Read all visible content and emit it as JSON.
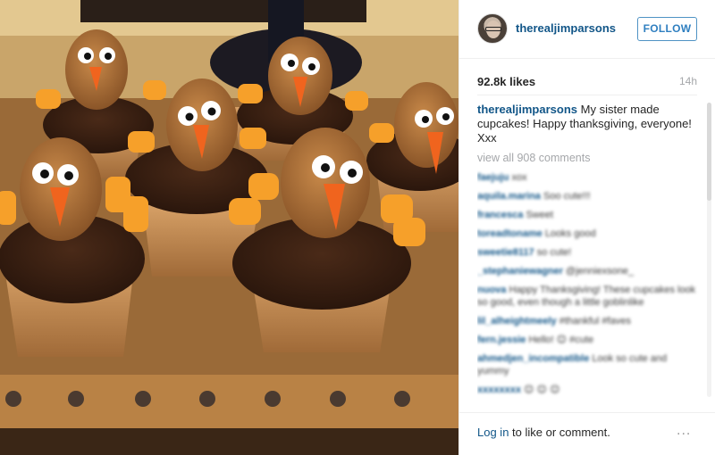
{
  "post": {
    "username": "therealjimparsons",
    "follow_label": "FOLLOW",
    "likes": "92.8k likes",
    "time_ago": "14h",
    "caption_user": "therealjimparsons",
    "caption_text": "My sister made cupcakes! Happy thanksgiving, everyone! Xxx",
    "view_all": "view all 908 comments",
    "comments": [
      {
        "user": "faejuju",
        "text": "xox"
      },
      {
        "user": "aquila.marina",
        "text": "Soo cute!!!"
      },
      {
        "user": "francesca",
        "text": "Sweet"
      },
      {
        "user": "toreadtoname",
        "text": "Looks good"
      },
      {
        "user": "sweetie8117",
        "text": "so cute!"
      },
      {
        "user": "_stephaniewagner",
        "text": "@jenniexsone_"
      },
      {
        "user": "nuova",
        "text": "Happy Thanksgiving! These cupcakes look so good, even though a little goblinlike"
      },
      {
        "user": "lil_alheightmeely",
        "text": "#thankful #faves"
      },
      {
        "user": "fern.jessie",
        "text": "Hello! 😊 #cute"
      },
      {
        "user": "ahmedjen_incompatible",
        "text": "Look so cute and yummy"
      },
      {
        "user": "xxxxxxxx",
        "text": "😊 😊 😊"
      }
    ],
    "login_link": "Log in",
    "login_rest": " to like or comment.",
    "more_icon": "..."
  },
  "colors": {
    "link": "#125688",
    "follow_border": "#4f93c4",
    "muted": "#a5a7aa"
  }
}
